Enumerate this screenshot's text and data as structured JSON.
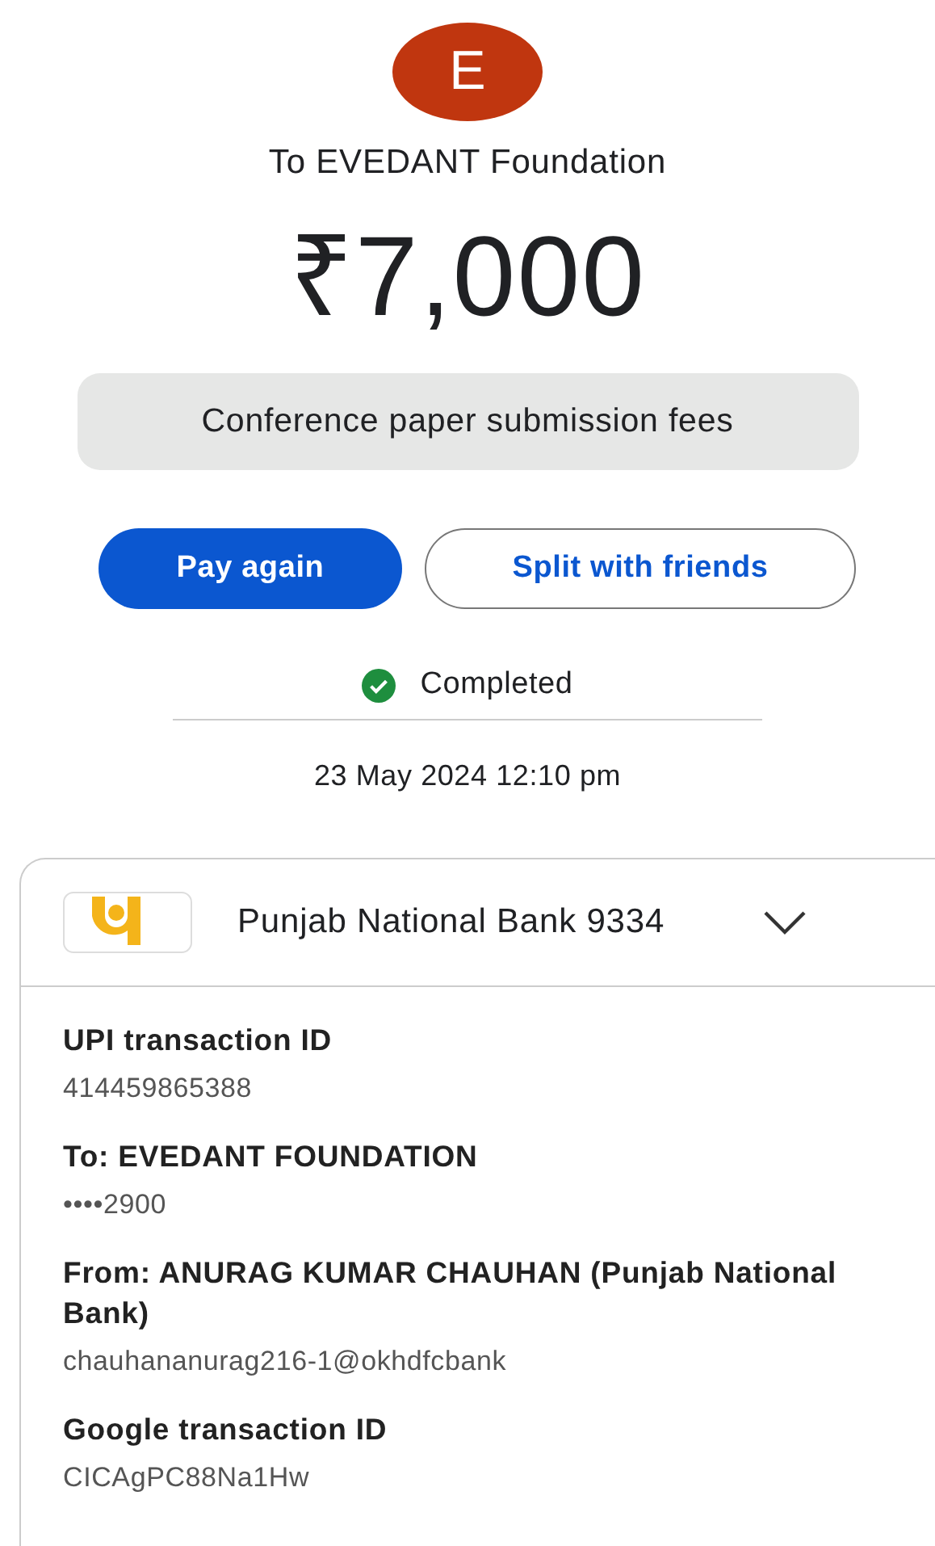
{
  "payee": {
    "initial": "E",
    "title": "To EVEDANT Foundation"
  },
  "amount": "₹7,000",
  "note": "Conference paper submission fees",
  "buttons": [
    {
      "label": "Pay again",
      "kind": "primary"
    },
    {
      "label": "Split with friends",
      "kind": "outline"
    }
  ],
  "status": {
    "label": "Completed"
  },
  "datetime": "23 May 2024 12:10 pm",
  "account": {
    "name": "Punjab National Bank 9334"
  },
  "details": [
    {
      "label": "UPI transaction ID",
      "value": "414459865388"
    },
    {
      "label": "To: EVEDANT FOUNDATION",
      "value": "••••2900"
    },
    {
      "label": "From: ANURAG KUMAR CHAUHAN (Punjab National Bank)",
      "value": "chauhananurag216-1@okhdfcbank"
    },
    {
      "label": "Google transaction ID",
      "value": "CICAgPC88Na1Hw"
    }
  ]
}
